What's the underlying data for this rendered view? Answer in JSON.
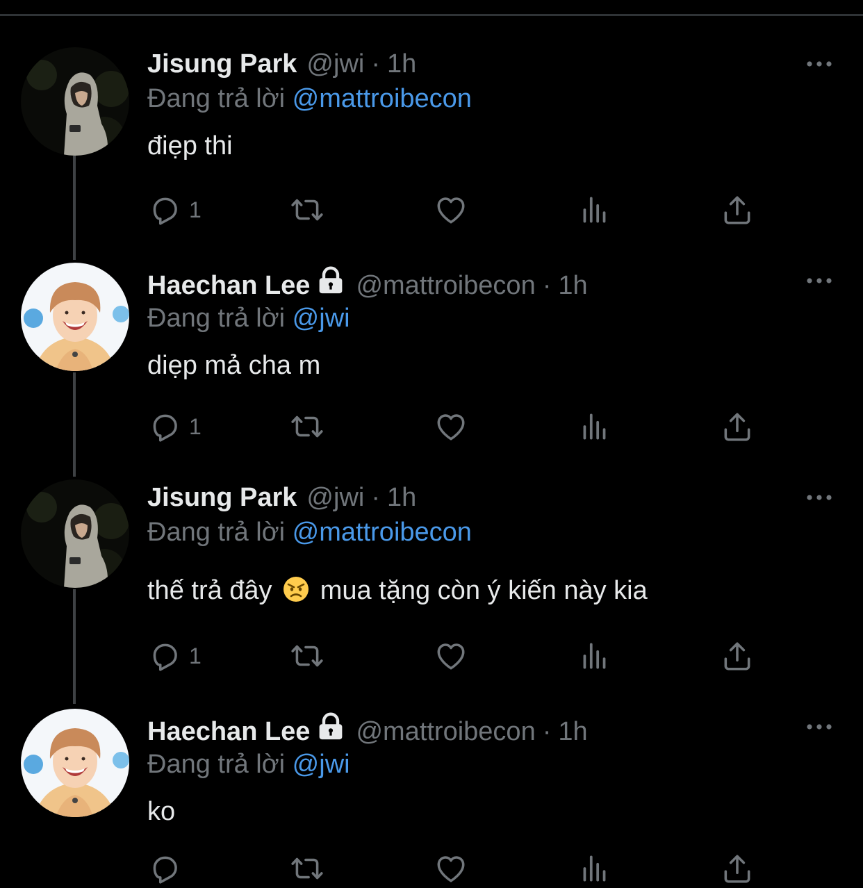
{
  "colors": {
    "background": "#000000",
    "primary_text": "#e7e9ea",
    "secondary_text": "#71767b",
    "link": "#4a99e9",
    "thread_line": "#3e4144"
  },
  "tweets": [
    {
      "name": "Jisung Park",
      "locked": false,
      "handle": "@jwi",
      "dot": "·",
      "time": "1h",
      "reply_prefix": "Đang trả lời",
      "reply_to": "@mattroibecon",
      "text": "điẹp thi",
      "reply_count": "1",
      "avatar": "avatar-jisung",
      "icons": [
        "reply-icon",
        "retweet-icon",
        "like-icon",
        "analytics-icon",
        "share-icon",
        "more-icon"
      ]
    },
    {
      "name": "Haechan Lee",
      "locked": true,
      "handle": "@mattroibecon",
      "dot": "·",
      "time": "1h",
      "reply_prefix": "Đang trả lời",
      "reply_to": "@jwi",
      "text": "diẹp mả cha m",
      "reply_count": "1",
      "avatar": "avatar-haechan",
      "icons": [
        "reply-icon",
        "retweet-icon",
        "like-icon",
        "analytics-icon",
        "share-icon",
        "more-icon"
      ]
    },
    {
      "name": "Jisung Park",
      "locked": false,
      "handle": "@jwi",
      "dot": "·",
      "time": "1h",
      "reply_prefix": "Đang trả lời",
      "reply_to": "@mattroibecon",
      "text_before_emoji": "thế trả đây",
      "emoji": "angry-face-emoji",
      "text_after_emoji": "mua tặng còn ý kiến này kia",
      "reply_count": "1",
      "avatar": "avatar-jisung",
      "icons": [
        "reply-icon",
        "retweet-icon",
        "like-icon",
        "analytics-icon",
        "share-icon",
        "more-icon"
      ]
    },
    {
      "name": "Haechan Lee",
      "locked": true,
      "handle": "@mattroibecon",
      "dot": "·",
      "time": "1h",
      "reply_prefix": "Đang trả lời",
      "reply_to": "@jwi",
      "text": "ko",
      "reply_count": "",
      "avatar": "avatar-haechan",
      "icons": [
        "reply-icon",
        "retweet-icon",
        "like-icon",
        "analytics-icon",
        "share-icon",
        "more-icon"
      ]
    }
  ]
}
